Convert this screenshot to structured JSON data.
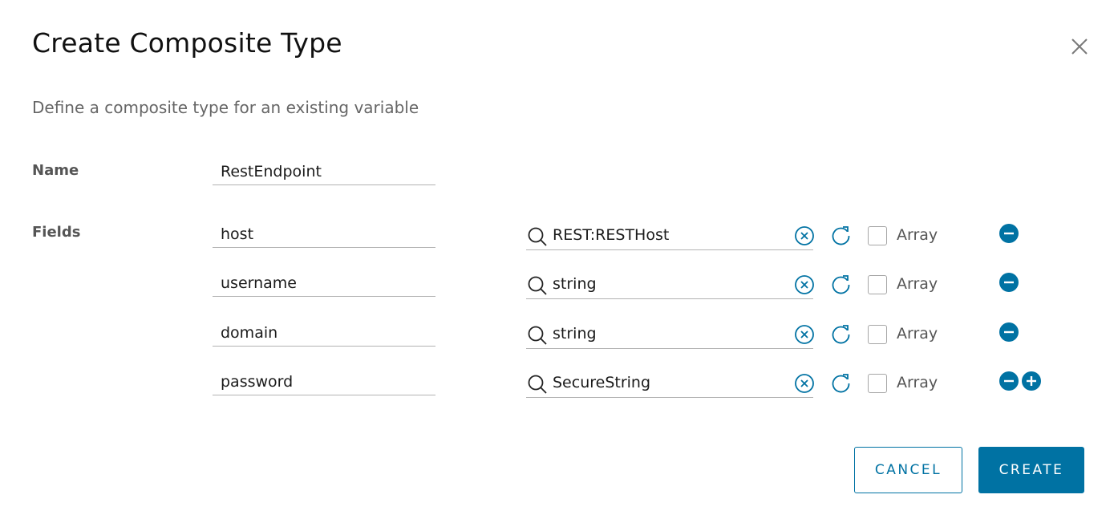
{
  "dialog": {
    "title": "Create Composite Type",
    "subtitle": "Define a composite type for an existing variable",
    "close_icon": "close-icon"
  },
  "form": {
    "name_label": "Name",
    "name_value": "RestEndpoint",
    "fields_label": "Fields",
    "array_label": "Array",
    "fields": [
      {
        "name": "host",
        "type": "REST:RESTHost",
        "array": false
      },
      {
        "name": "username",
        "type": "string",
        "array": false
      },
      {
        "name": "domain",
        "type": "string",
        "array": false
      },
      {
        "name": "password",
        "type": "SecureString",
        "array": false
      }
    ]
  },
  "actions": {
    "cancel_label": "CANCEL",
    "create_label": "CREATE"
  },
  "colors": {
    "accent": "#0072a3",
    "muted_text": "#666666",
    "border": "#b3b3b3"
  }
}
